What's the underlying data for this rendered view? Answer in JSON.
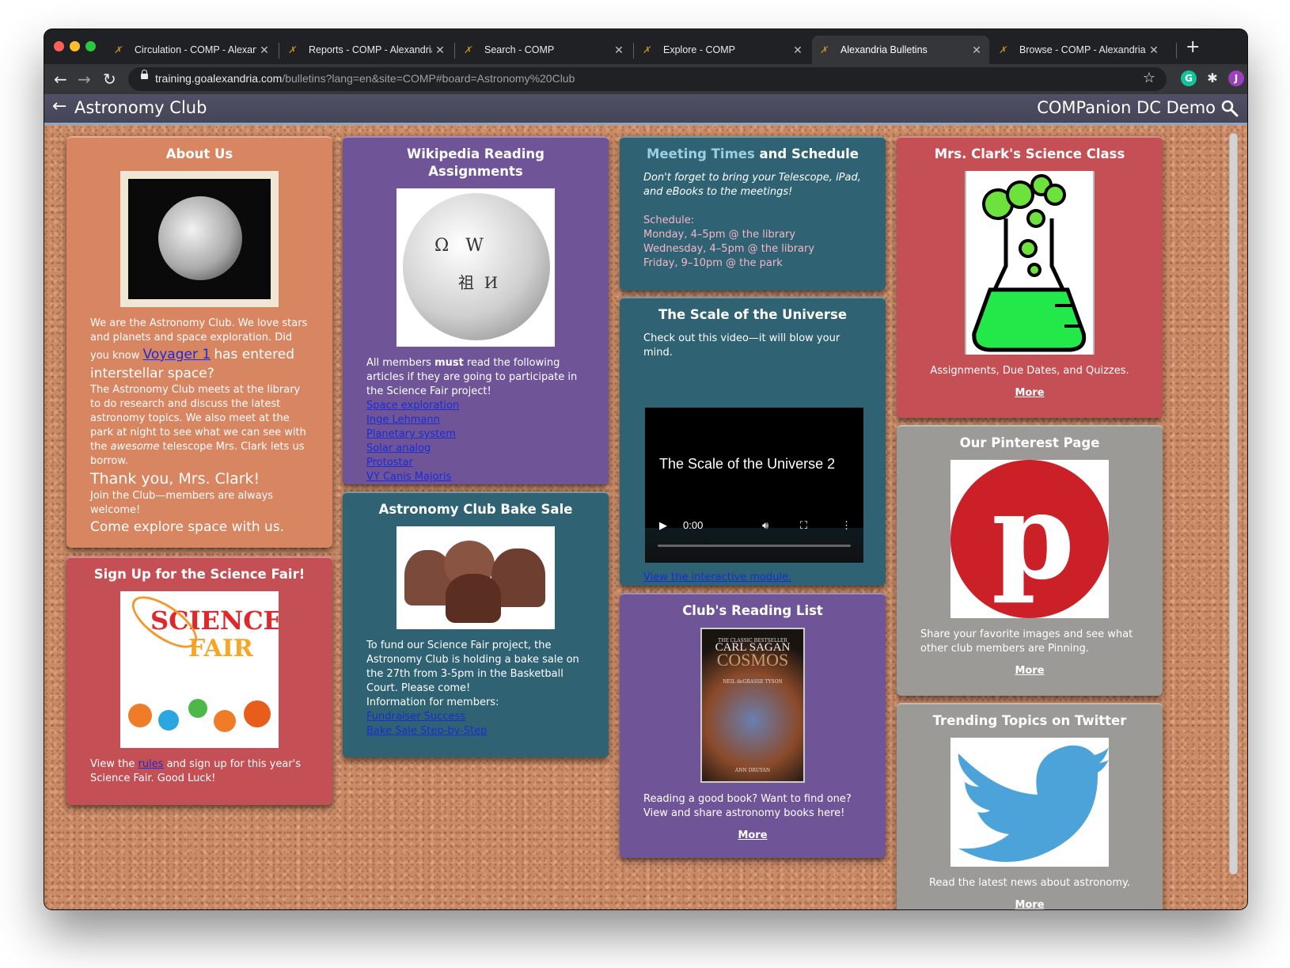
{
  "browser": {
    "tabs": [
      {
        "title": "Circulation - COMP - Alexandria",
        "active": false
      },
      {
        "title": "Reports - COMP - Alexandria",
        "active": false
      },
      {
        "title": "Search - COMP",
        "active": false
      },
      {
        "title": "Explore - COMP",
        "active": false
      },
      {
        "title": "Alexandria Bulletins",
        "active": true
      },
      {
        "title": "Browse - COMP - Alexandria",
        "active": false
      }
    ],
    "url_host": "training.goalexandria.com",
    "url_path": "/bulletins?lang=en&site=COMP#board=Astronomy%20Club",
    "profile_initial": "J",
    "extension_initial": "G",
    "colors": {
      "close": "#ff5f57",
      "minimize": "#febc2e",
      "zoom": "#28c840",
      "profile": "#9c3fbd",
      "grammarly": "#15c39a"
    }
  },
  "header": {
    "title": "Astronomy Club",
    "site": "COMPanion DC Demo"
  },
  "cards": {
    "about": {
      "title": "About Us",
      "image_alt": "Engraving of the moon",
      "p1": "We are the Astronomy Club. We love stars and planets and space exploration. Did you know",
      "link": "Voyager 1",
      "p1_end": "has entered interstellar space?",
      "p2_a": "The Astronomy Club meets at the library to do research and discuss the latest astronomy topics. We also meet at the park at night to see what we can see with the",
      "p2_em": "awesome",
      "p2_b": "telescope Mrs. Clark lets us borrow.",
      "thanks": "Thank you, Mrs. Clark!",
      "join": "Join the Club—members are always welcome!",
      "explore": "Come explore space with us."
    },
    "signup": {
      "title": "Sign Up for the Science Fair!",
      "image_alt": "Science Fair logo",
      "text_a": "View the",
      "link": "rules",
      "text_b": "and sign up for this year's Science Fair. Good Luck!"
    },
    "wikipedia": {
      "title": "Wikipedia Reading Assignments",
      "image_alt": "Wikipedia globe",
      "text_a": "All members",
      "text_strong": "must",
      "text_b": "read the following articles if they are going to participate in the Science Fair project!",
      "links": [
        "Space exploration",
        "Inge Lehmann",
        "Planetary system",
        "Solar analog",
        "Protostar",
        "VY Canis Majoris"
      ]
    },
    "bakesale": {
      "title": "Astronomy Club Bake Sale",
      "image_alt": "Chocolate cupcakes",
      "text": "To fund our Science Fair project, the Astronomy Club is holding a bake sale on the 27th from 3-5pm in the Basketball Court. Please come!",
      "info": "Information for members:",
      "links": [
        "Fundraiser Success",
        "Bake Sale Step-by-Step"
      ]
    },
    "meeting": {
      "title_a": "Meeting Times",
      "title_b": "and Schedule",
      "note": "Don't forget to bring your Telescope, iPad, and eBooks to the meetings!",
      "schedule_label": "Schedule:",
      "schedule": [
        "Monday, 4–5pm @ the library",
        "Wednesday, 4–5pm @ the library",
        "Friday, 9–10pm @ the park"
      ]
    },
    "scale": {
      "title": "The Scale of the Universe",
      "text": "Check out this video—it will blow your mind.",
      "video_title": "The Scale of the Universe 2",
      "video_time": "0:00",
      "video_progress": 0,
      "link": "View the interactive module."
    },
    "reading": {
      "title": "Club's Reading List",
      "book_top": "THE CLASSIC BESTSELLER",
      "book_author": "CARL SAGAN",
      "book_title": "COSMOS",
      "book_foreword": "NEIL deGRASSE TYSON",
      "book_bottom": "ANN DRUYAN",
      "text": "Reading a good book? Want to find one? View and share astronomy books here!",
      "more": "More"
    },
    "clark": {
      "title": "Mrs. Clark's Science Class",
      "image_alt": "Bubbling flask",
      "text": "Assignments, Due Dates, and Quizzes.",
      "more": "More"
    },
    "pinterest": {
      "title": "Our Pinterest Page",
      "image_alt": "Pinterest logo",
      "text": "Share your favorite images and see what other club members are Pinning.",
      "more": "More"
    },
    "twitter": {
      "title": "Trending Topics on Twitter",
      "image_alt": "Twitter bird logo",
      "text": "Read the latest news about astronomy.",
      "more": "More"
    }
  }
}
